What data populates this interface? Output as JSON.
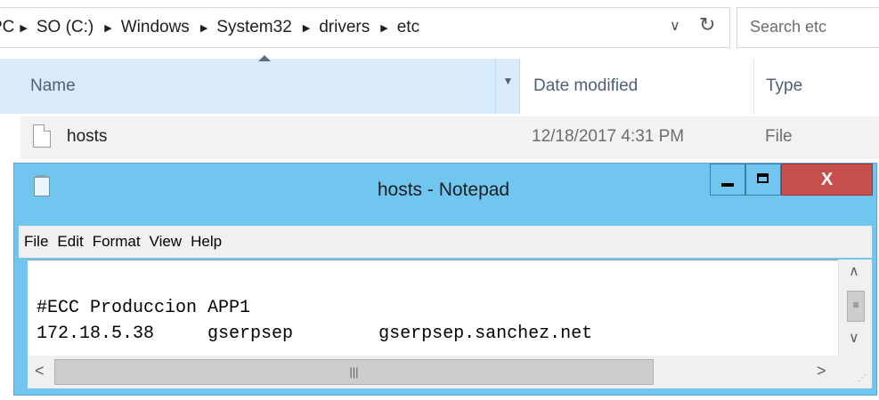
{
  "explorer": {
    "breadcrumb": [
      "PC",
      "SO (C:)",
      "Windows",
      "System32",
      "drivers",
      "etc"
    ],
    "search_placeholder": "Search etc",
    "columns": {
      "name": "Name",
      "date": "Date modified",
      "type": "Type"
    },
    "files": [
      {
        "name": "hosts",
        "date": "12/18/2017 4:31 PM",
        "type": "File"
      }
    ]
  },
  "notepad": {
    "title": "hosts - Notepad",
    "close_label": "X",
    "menu": [
      "File",
      "Edit",
      "Format",
      "View",
      "Help"
    ],
    "lines": [
      "#ECC Produccion APP1",
      "172.18.5.38     gserpsep        gserpsep.sanchez.net"
    ]
  }
}
